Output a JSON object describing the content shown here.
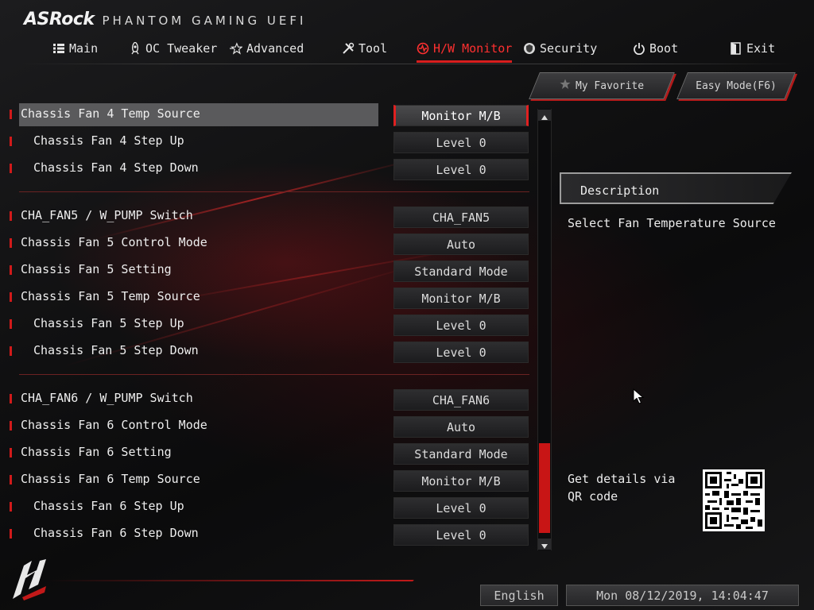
{
  "brand": {
    "logo_text": "ASRock",
    "subtitle": "PHANTOM GAMING UEFI"
  },
  "nav": [
    {
      "label": "Main",
      "icon": "list-icon"
    },
    {
      "label": "OC Tweaker",
      "icon": "rocket-icon"
    },
    {
      "label": "Advanced",
      "icon": "star-icon"
    },
    {
      "label": "Tool",
      "icon": "tools-icon"
    },
    {
      "label": "H/W Monitor",
      "icon": "monitor-icon",
      "active": true
    },
    {
      "label": "Security",
      "icon": "shield-icon"
    },
    {
      "label": "Boot",
      "icon": "power-icon"
    },
    {
      "label": "Exit",
      "icon": "exit-icon"
    }
  ],
  "buttons": {
    "my_favorite": "My Favorite",
    "easy_mode": "Easy Mode(F6)"
  },
  "settings": [
    {
      "label": "Chassis Fan 4 Temp Source",
      "value": "Monitor M/B",
      "selected": true
    },
    {
      "label": "Chassis Fan 4 Step Up",
      "value": "Level 0"
    },
    {
      "label": "Chassis Fan 4 Step Down",
      "value": "Level 0"
    },
    {
      "label": "CHA_FAN5 / W_PUMP Switch",
      "value": "CHA_FAN5"
    },
    {
      "label": "Chassis Fan 5 Control Mode",
      "value": "Auto"
    },
    {
      "label": "Chassis Fan 5 Setting",
      "value": "Standard Mode"
    },
    {
      "label": "Chassis Fan 5 Temp Source",
      "value": "Monitor M/B"
    },
    {
      "label": "Chassis Fan 5 Step Up",
      "value": "Level 0"
    },
    {
      "label": "Chassis Fan 5 Step Down",
      "value": "Level 0"
    },
    {
      "label": "CHA_FAN6 / W_PUMP Switch",
      "value": "CHA_FAN6"
    },
    {
      "label": "Chassis Fan 6 Control Mode",
      "value": "Auto"
    },
    {
      "label": "Chassis Fan 6 Setting",
      "value": "Standard Mode"
    },
    {
      "label": "Chassis Fan 6 Temp Source",
      "value": "Monitor M/B"
    },
    {
      "label": "Chassis Fan 6 Step Up",
      "value": "Level 0"
    },
    {
      "label": "Chassis Fan 6 Step Down",
      "value": "Level 0"
    }
  ],
  "description": {
    "title": "Description",
    "text": "Select Fan Temperature Source",
    "qr_text": "Get details via QR code"
  },
  "footer": {
    "language": "English",
    "datetime": "Mon 08/12/2019, 14:04:47"
  },
  "colors": {
    "accent": "#d81e1e",
    "panel": "#2a2a2c",
    "text": "#e8e8e8"
  }
}
